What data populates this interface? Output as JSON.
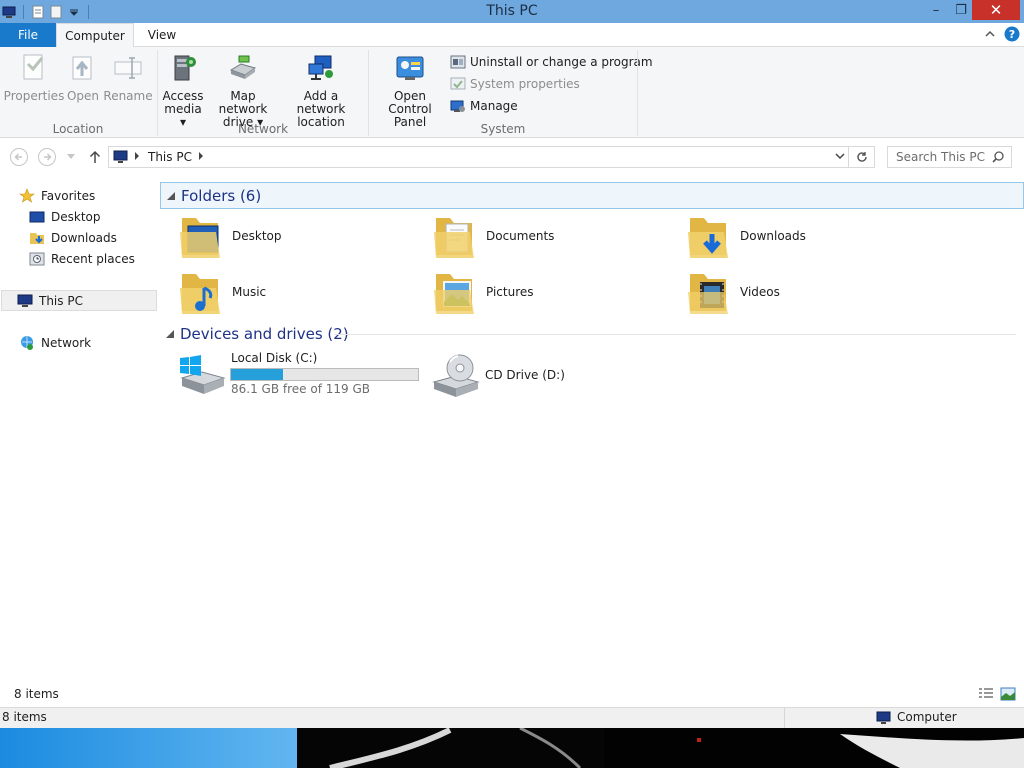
{
  "window": {
    "title": "This PC",
    "controls": {
      "minimize": "–",
      "restore": "❐",
      "close": "✕"
    }
  },
  "tabs": [
    {
      "label": "File"
    },
    {
      "label": "Computer"
    },
    {
      "label": "View"
    }
  ],
  "ribbon": {
    "location": {
      "group_label": "Location",
      "properties": "Properties",
      "open": "Open",
      "rename": "Rename"
    },
    "network": {
      "group_label": "Network",
      "access_media": [
        "Access",
        "media ▾"
      ],
      "map_drive": [
        "Map network",
        "drive ▾"
      ],
      "add_location": [
        "Add a network",
        "location"
      ]
    },
    "system": {
      "group_label": "System",
      "open_cp": [
        "Open Control",
        "Panel"
      ],
      "uninstall": "Uninstall or change a program",
      "sys_props": "System properties",
      "manage": "Manage"
    }
  },
  "address": {
    "path": "This PC",
    "search_placeholder": "Search This PC"
  },
  "nav": {
    "favorites": "Favorites",
    "desktop": "Desktop",
    "downloads": "Downloads",
    "recent": "Recent places",
    "this_pc": "This PC",
    "network": "Network"
  },
  "content": {
    "folders_header": "Folders (6)",
    "folders": [
      "Desktop",
      "Documents",
      "Downloads",
      "Music",
      "Pictures",
      "Videos"
    ],
    "devices_header": "Devices and drives (2)",
    "drive_c": {
      "name": "Local Disk (C:)",
      "free": "86.1 GB free of 119 GB",
      "used_fraction": 0.28
    },
    "drive_d": {
      "name": "CD Drive (D:)"
    }
  },
  "status": {
    "items": "8 items",
    "bottom_items": "8 items",
    "location": "Computer"
  },
  "colors": {
    "titlebar": "#6ea8de",
    "file_tab": "#1979ca",
    "close": "#c7312a",
    "progress": "#26a0da",
    "header_text": "#1e3287"
  }
}
